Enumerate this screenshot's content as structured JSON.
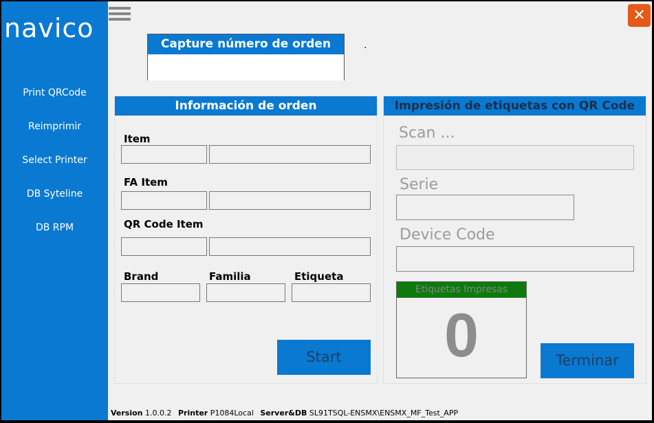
{
  "sidebar": {
    "logo": "navico",
    "items": [
      {
        "label": "Print QRCode"
      },
      {
        "label": "Reimprimir"
      },
      {
        "label": "Select Printer"
      },
      {
        "label": "DB Syteline"
      },
      {
        "label": "DB RPM"
      }
    ]
  },
  "close_label": "✕",
  "capture": {
    "title": "Capture número de orden",
    "value": "",
    "dot": "."
  },
  "info": {
    "title": "Información de orden",
    "item_label": "Item",
    "fa_item_label": "FA Item",
    "qr_code_item_label": "QR Code  Item",
    "brand_label": "Brand",
    "familia_label": "Familia",
    "etiqueta_label": "Etiqueta",
    "start_label": "Start"
  },
  "print": {
    "title": "Impresión de etiquetas con QR Code",
    "scan_label": "Scan ...",
    "serie_label": "Serie",
    "device_code_label": "Device Code",
    "counter_title": "Etiquetas Impresas",
    "counter_value": "0",
    "terminar_label": "Terminar"
  },
  "status": {
    "version_label": "Version",
    "version_value": "1.0.0.2",
    "printer_label": "Printer",
    "printer_value": "P1084Local",
    "server_label": "Server&DB",
    "server_value": "SL91TSQL-ENSMX\\ENSMX_MF_Test_APP"
  },
  "colors": {
    "accent": "#0a79d1",
    "close": "#e55a17",
    "counter_header": "#0e7a0e"
  }
}
